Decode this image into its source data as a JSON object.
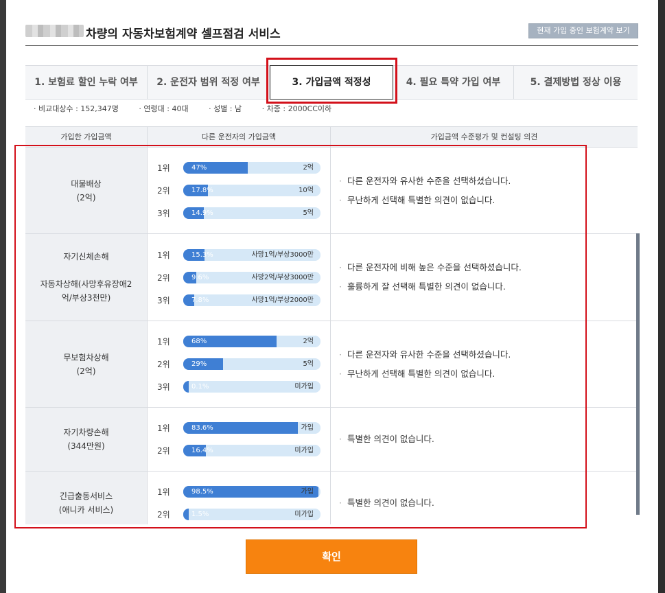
{
  "header": {
    "title": "차량의 자동차보험계약 셀프점검 서비스",
    "view_button": "현재 가입 중인 보험계약 보기"
  },
  "tabs": [
    {
      "label": "1. 보험료 할인 누락 여부",
      "active": false
    },
    {
      "label": "2. 운전자 범위 적정 여부",
      "active": false
    },
    {
      "label": "3. 가입금액 적정성",
      "active": true
    },
    {
      "label": "4. 필요 특약 가입 여부",
      "active": false
    },
    {
      "label": "5. 결제방법 정상 이용",
      "active": false
    }
  ],
  "filters": [
    "· 비교대상수 : 152,347명",
    "· 연령대 : 40대",
    "· 성별 : 남",
    "· 차종 : 2000CC이하"
  ],
  "table": {
    "columns": [
      "가입한 가입금액",
      "다른 운전자의 가입금액",
      "가입금액 수준평가 및 컨설팅 의견"
    ],
    "rows": [
      {
        "coverage": [
          "대물배상",
          "(2억)"
        ],
        "ranks": [
          {
            "rank": "1위",
            "pct": "47%",
            "value": 47,
            "amount": "2억"
          },
          {
            "rank": "2위",
            "pct": "17.8%",
            "value": 17.8,
            "amount": "10억"
          },
          {
            "rank": "3위",
            "pct": "14.9%",
            "value": 14.9,
            "amount": "5억"
          }
        ],
        "opinions": [
          "다른 운전자와 유사한 수준을 선택하셨습니다.",
          "무난하게 선택해 특별한 의견이 없습니다."
        ]
      },
      {
        "coverage": [
          "자기신체손해",
          "",
          "자동차상해(사망후유장애2",
          "억/부상3천만)"
        ],
        "ranks": [
          {
            "rank": "1위",
            "pct": "15.3%",
            "value": 15.3,
            "amount": "사망1억/부상3000만"
          },
          {
            "rank": "2위",
            "pct": "9.6%",
            "value": 9.6,
            "amount": "사망2억/부상3000만"
          },
          {
            "rank": "3위",
            "pct": "7.8%",
            "value": 7.8,
            "amount": "사망1억/부상2000만"
          }
        ],
        "opinions": [
          "다른 운전자에 비해 높은 수준을 선택하셨습니다.",
          "훌륭하게 잘 선택해 특별한 의견이 없습니다."
        ]
      },
      {
        "coverage": [
          "무보험차상해",
          "(2억)"
        ],
        "ranks": [
          {
            "rank": "1위",
            "pct": "68%",
            "value": 68,
            "amount": "2억"
          },
          {
            "rank": "2위",
            "pct": "29%",
            "value": 29,
            "amount": "5억"
          },
          {
            "rank": "3위",
            "pct": "0.1%",
            "value": 0.1,
            "amount": "미가입"
          }
        ],
        "opinions": [
          "다른 운전자와 유사한 수준을 선택하셨습니다.",
          "무난하게 선택해 특별한 의견이 없습니다."
        ]
      },
      {
        "coverage": [
          "자기차량손해",
          "(344만원)"
        ],
        "ranks": [
          {
            "rank": "1위",
            "pct": "83.6%",
            "value": 83.6,
            "amount": "가입"
          },
          {
            "rank": "2위",
            "pct": "16.4%",
            "value": 16.4,
            "amount": "미가입"
          }
        ],
        "opinions": [
          "특별한 의견이 없습니다."
        ]
      },
      {
        "coverage": [
          "긴급출동서비스",
          "(애니카 서비스)"
        ],
        "ranks": [
          {
            "rank": "1위",
            "pct": "98.5%",
            "value": 98.5,
            "amount": "가입"
          },
          {
            "rank": "2위",
            "pct": "1.5%",
            "value": 1.5,
            "amount": "미가입"
          }
        ],
        "opinions": [
          "특별한 의견이 없습니다."
        ]
      }
    ]
  },
  "confirm_label": "확인",
  "colors": {
    "accent_orange": "#f7830f",
    "bar_fill": "#3f7fd4",
    "bar_track": "#d6e8f7",
    "highlight_red": "#d3101a"
  }
}
